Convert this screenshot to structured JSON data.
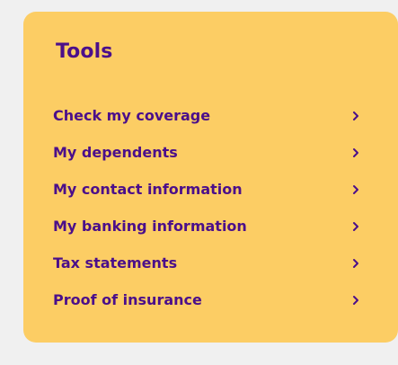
{
  "tools": {
    "title": "Tools",
    "colors": {
      "card_bg": "#fccd64",
      "text": "#4b0f8a",
      "page_bg": "#f0f0f0"
    },
    "items": [
      {
        "label": "Check my coverage",
        "icon": "chevron-right-icon"
      },
      {
        "label": "My dependents",
        "icon": "chevron-right-icon"
      },
      {
        "label": "My contact information",
        "icon": "chevron-right-icon"
      },
      {
        "label": "My banking information",
        "icon": "chevron-right-icon"
      },
      {
        "label": "Tax statements",
        "icon": "chevron-right-icon"
      },
      {
        "label": "Proof of insurance",
        "icon": "chevron-right-icon"
      }
    ]
  }
}
